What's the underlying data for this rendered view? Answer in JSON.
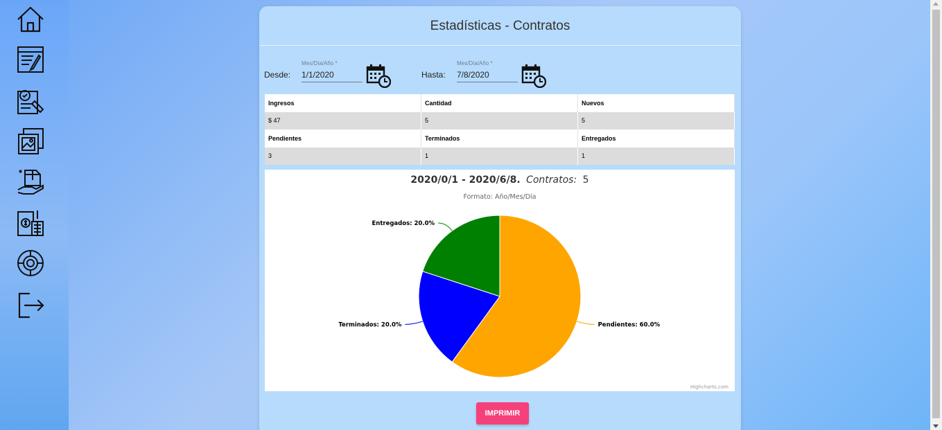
{
  "sidebar": {
    "items": [
      {
        "icon": "home-icon"
      },
      {
        "icon": "contract-edit-icon"
      },
      {
        "icon": "contract-review-icon"
      },
      {
        "icon": "gallery-icon"
      },
      {
        "icon": "delivery-package-icon"
      },
      {
        "icon": "billing-calculator-icon"
      },
      {
        "icon": "settings-gear-icon"
      },
      {
        "icon": "logout-icon"
      }
    ]
  },
  "page": {
    "title": "Estadísticas - Contratos"
  },
  "filters": {
    "from_label": "Desde:",
    "from_placeholder": "Mes/Día/Año *",
    "from_value": "1/1/2020",
    "to_label": "Hasta:",
    "to_placeholder": "Mes/Día/Año *",
    "to_value": "7/8/2020"
  },
  "stats": {
    "rows": [
      {
        "headers": [
          "Ingresos",
          "Cantidad",
          "Nuevos"
        ],
        "values": [
          "$ 47",
          "5",
          "5"
        ]
      },
      {
        "headers": [
          "Pendientes",
          "Terminados",
          "Entregados"
        ],
        "values": [
          "3",
          "1",
          "1"
        ]
      }
    ]
  },
  "chart_data": {
    "type": "pie",
    "title_bold": "2020/0/1 - 2020/6/8.",
    "title_italic": "Contratos:",
    "title_count": "5",
    "subtitle": "Formato: Año/Mes/Día",
    "slices": [
      {
        "name": "Pendientes",
        "value": 60.0,
        "label": "Pendientes: 60.0%",
        "color": "#ffa500"
      },
      {
        "name": "Terminados",
        "value": 20.0,
        "label": "Terminados: 20.0%",
        "color": "#0000ff"
      },
      {
        "name": "Entregados",
        "value": 20.0,
        "label": "Entregados: 20.0%",
        "color": "#008000"
      }
    ],
    "credits": "Highcharts.com"
  },
  "actions": {
    "print_label": "IMPRIMIR"
  },
  "colors": {
    "card_bg": "#b7dbfc",
    "print_button": "#f5407a"
  }
}
